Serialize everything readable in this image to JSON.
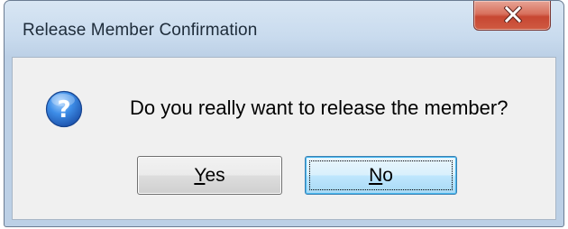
{
  "window": {
    "title": "Release Member Confirmation",
    "close_icon": "close-x-icon"
  },
  "dialog": {
    "icon": "question-icon",
    "message": "Do you really want to release the member?",
    "buttons": {
      "yes": {
        "mnemonic": "Y",
        "rest": "es",
        "label": "Yes"
      },
      "no": {
        "mnemonic": "N",
        "rest": "o",
        "label": "No",
        "focused": true
      }
    }
  },
  "colors": {
    "title_bar": "#c9dbee",
    "close_button": "#c74732",
    "client_area": "#f0f0f0",
    "focused_button_border": "#3c7fb1"
  }
}
